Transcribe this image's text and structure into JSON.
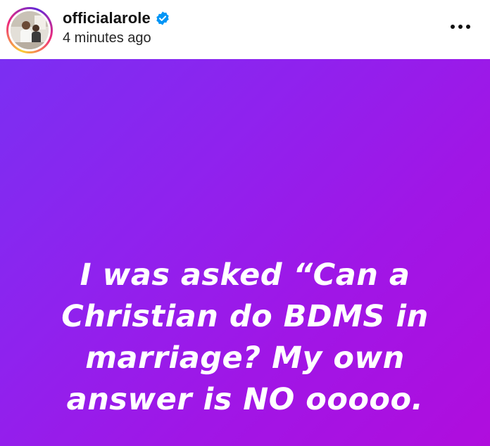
{
  "header": {
    "username": "officialarole",
    "timestamp": "4 minutes ago",
    "verified_color": "#0095f6",
    "avatar_icon": "profile-photo",
    "more_icon": "more-horizontal-icon"
  },
  "post": {
    "text": "I was asked “Can a\nChristian do BDMS in\nmarriage? My own\nanswer is NO ooooo.",
    "background_colors": [
      "#7b2ff2",
      "#b00ddd"
    ],
    "text_color": "#ffffff"
  }
}
